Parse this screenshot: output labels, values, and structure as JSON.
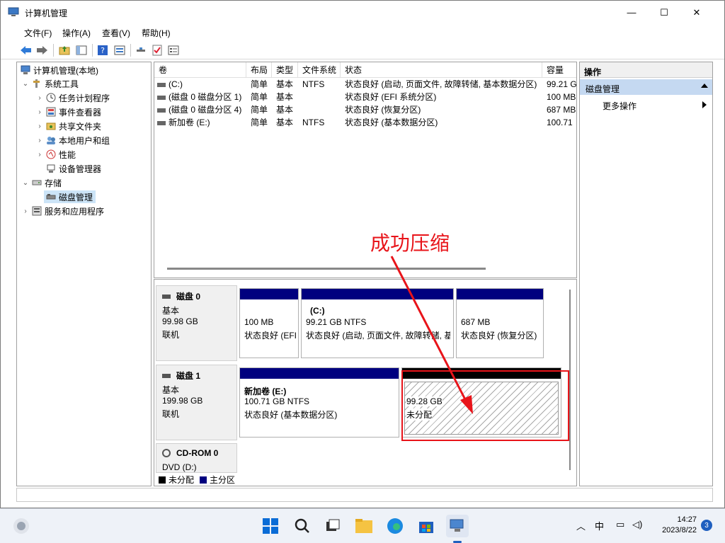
{
  "window": {
    "title": "计算机管理",
    "minimize": "—",
    "maximize": "☐",
    "close": "✕"
  },
  "menu": [
    "文件(F)",
    "操作(A)",
    "查看(V)",
    "帮助(H)"
  ],
  "tree": {
    "root": "计算机管理(本地)",
    "system_tools": "系统工具",
    "task_scheduler": "任务计划程序",
    "event_viewer": "事件查看器",
    "shared_folders": "共享文件夹",
    "local_users": "本地用户和组",
    "performance": "性能",
    "device_manager": "设备管理器",
    "storage": "存储",
    "disk_management": "磁盘管理",
    "services": "服务和应用程序"
  },
  "volumes": {
    "headers": [
      "卷",
      "布局",
      "类型",
      "文件系统",
      "状态",
      "容量"
    ],
    "rows": [
      [
        "(C:)",
        "简单",
        "基本",
        "NTFS",
        "状态良好 (启动, 页面文件, 故障转储, 基本数据分区)",
        "99.21 G"
      ],
      [
        "(磁盘 0 磁盘分区 1)",
        "简单",
        "基本",
        "",
        "状态良好 (EFI 系统分区)",
        "100 MB"
      ],
      [
        "(磁盘 0 磁盘分区 4)",
        "简单",
        "基本",
        "",
        "状态良好 (恢复分区)",
        "687 MB"
      ],
      [
        "新加卷 (E:)",
        "简单",
        "基本",
        "NTFS",
        "状态良好 (基本数据分区)",
        "100.71"
      ]
    ]
  },
  "disks": {
    "disk0": {
      "name": "磁盘 0",
      "type": "基本",
      "size": "99.98 GB",
      "status": "联机",
      "p1": {
        "size": "100 MB",
        "status": "状态良好 (EFI"
      },
      "p2": {
        "label": "(C:)",
        "size": "99.21 GB NTFS",
        "status": "状态良好 (启动, 页面文件, 故障转储, 基"
      },
      "p3": {
        "size": "687 MB",
        "status": "状态良好 (恢复分区)"
      }
    },
    "disk1": {
      "name": "磁盘 1",
      "type": "基本",
      "size": "199.98 GB",
      "status": "联机",
      "p1": {
        "label": "新加卷  (E:)",
        "size": "100.71 GB NTFS",
        "status": "状态良好 (基本数据分区)"
      },
      "p2": {
        "size": "99.28 GB",
        "status": "未分配"
      }
    },
    "cdrom": {
      "name": "CD-ROM 0",
      "type": "DVD (D:)"
    }
  },
  "legend": {
    "unallocated": "未分配",
    "primary": "主分区"
  },
  "actions": {
    "header": "操作",
    "section": "磁盘管理",
    "more": "更多操作"
  },
  "annotation": "成功压缩",
  "taskbar": {
    "ime": "中",
    "time": "14:27",
    "date": "2023/8/22",
    "notifications": "3"
  },
  "colors": {
    "primary_partition": "#00007f",
    "unallocated": "#000000",
    "annotation": "#e8141a"
  }
}
